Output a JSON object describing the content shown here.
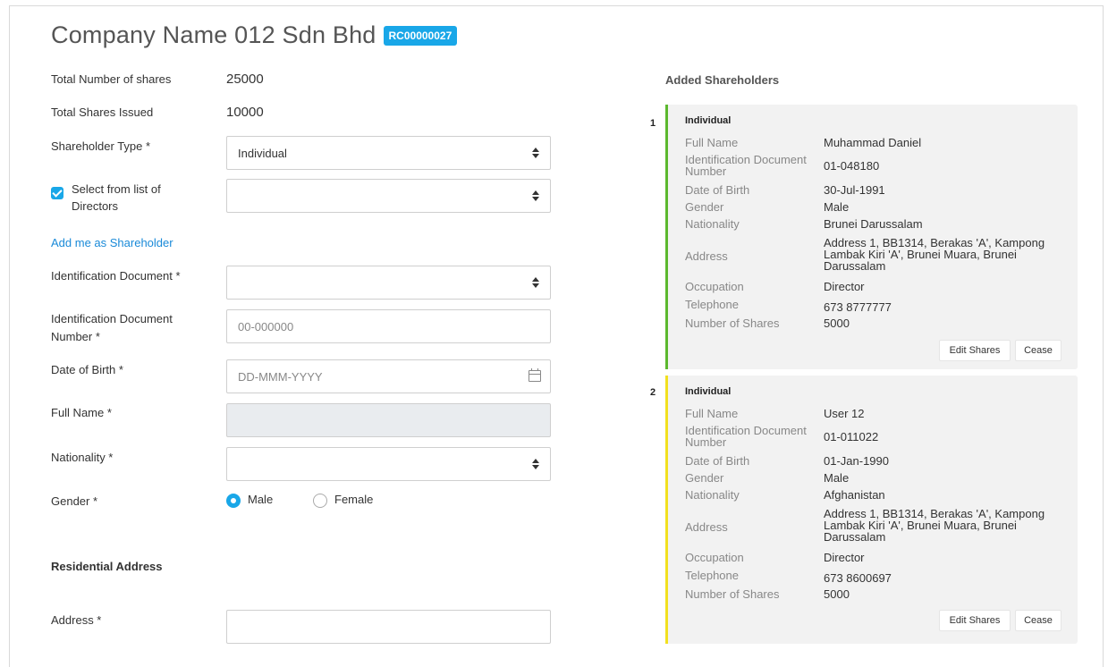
{
  "header": {
    "company_name": "Company Name 012 Sdn Bhd",
    "reg_no": "RC00000027"
  },
  "summary": {
    "total_shares_label": "Total Number of shares",
    "total_shares_value": "25000",
    "issued_label": "Total Shares Issued",
    "issued_value": "10000"
  },
  "form": {
    "shareholder_type_label": "Shareholder Type *",
    "shareholder_type_value": "Individual",
    "select_directors_label_1": "Select from list of",
    "select_directors_label_2": "Directors",
    "add_me_link": "Add me as Shareholder",
    "id_doc_label": "Identification Document *",
    "id_doc_number_label_1": "Identification Document",
    "id_doc_number_label_2": "Number *",
    "id_doc_number_placeholder": "00-000000",
    "dob_label": "Date of Birth *",
    "dob_placeholder": "DD-MMM-YYYY",
    "full_name_label": "Full Name *",
    "nationality_label": "Nationality *",
    "gender_label": "Gender *",
    "gender_male": "Male",
    "gender_female": "Female",
    "residential_section": "Residential Address",
    "address_label": "Address *"
  },
  "added": {
    "title": "Added Shareholders",
    "field_labels": {
      "full_name": "Full Name",
      "id_doc_1": "Identification Document",
      "id_doc_2": "Number",
      "dob": "Date of Birth",
      "gender": "Gender",
      "nationality": "Nationality",
      "address": "Address",
      "occupation": "Occupation",
      "telephone": "Telephone",
      "shares": "Number of Shares"
    },
    "edit_label": "Edit Shares",
    "cease_label": "Cease",
    "cards": [
      {
        "num": "1",
        "type": "Individual",
        "full_name": "Muhammad Daniel",
        "id_number": "01-048180",
        "dob": "30-Jul-1991",
        "gender": "Male",
        "nationality": "Brunei Darussalam",
        "address_1": "Address 1, BB1314, Berakas 'A', Kampong",
        "address_2": "Lambak Kiri 'A', Brunei Muara, Brunei",
        "address_3": "Darussalam",
        "occupation": "Director",
        "telephone": "673 8777777",
        "shares": "5000",
        "bar_color": "#5cb82e"
      },
      {
        "num": "2",
        "type": "Individual",
        "full_name": "User 12",
        "id_number": "01-011022",
        "dob": "01-Jan-1990",
        "gender": "Male",
        "nationality": "Afghanistan",
        "address_1": "Address 1, BB1314, Berakas 'A', Kampong",
        "address_2": "Lambak Kiri 'A', Brunei Muara, Brunei",
        "address_3": "Darussalam",
        "occupation": "Director",
        "telephone": "673 8600697",
        "shares": "5000",
        "bar_color": "#f2e01f"
      }
    ]
  }
}
